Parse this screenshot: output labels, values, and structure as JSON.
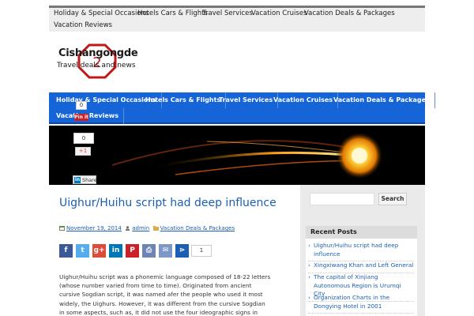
{
  "top_nav": [
    "Holiday & Special Occasions",
    "Hotels Cars & Flights",
    "Travel Services",
    "Vacation Cruises",
    "Vacation Deals & Packages",
    "Vacation Reviews"
  ],
  "logo": {
    "name": "Cishangongde",
    "tagline": "Travel deals and news"
  },
  "main_nav": [
    "Holiday & Special Occasions",
    "Hotels Cars & Flights",
    "Travel Services",
    "Vacation Cruises",
    "Vacation Deals & Packages",
    "Vacation Reviews"
  ],
  "floating_share": {
    "pin_count": "0",
    "pin_label": "Pin it",
    "gplus_count": "0",
    "gplus_label": "+1",
    "linkedin_label": "Share"
  },
  "post": {
    "title": "Uighur/Huihu script had deep influence",
    "date": "November 19, 2014",
    "author": "admin",
    "category": "Vacation Deals & Packages",
    "share_count": "1",
    "body": "Uighur/Huihu script was a phonemic language composed of 18-22 letters (whose number varied from time to time). Originated from ancient cursive Sogdian script, it was named afer the people who used it most widely, the Uighurs. However, it was different from the cursive Sogdian in some aspects, such as, it did not use the four ideographic signs in Sogdian and added"
  },
  "share_icons": [
    {
      "name": "facebook-icon",
      "glyph": "f",
      "color": "#3b5998"
    },
    {
      "name": "twitter-icon",
      "glyph": "t",
      "color": "#55acee"
    },
    {
      "name": "google-plus-icon",
      "glyph": "g+",
      "color": "#dd4b39"
    },
    {
      "name": "linkedin-icon",
      "glyph": "in",
      "color": "#0077b5"
    },
    {
      "name": "pinterest-icon",
      "glyph": "P",
      "color": "#cb2027"
    },
    {
      "name": "print-icon",
      "glyph": "⎙",
      "color": "#6d84b4"
    },
    {
      "name": "email-icon",
      "glyph": "✉",
      "color": "#7d98c8"
    },
    {
      "name": "share-more-icon",
      "glyph": "⋗",
      "color": "#1a5fb4"
    }
  ],
  "sidebar": {
    "search_button": "Search",
    "recent_title": "Recent Posts",
    "recent_posts": [
      "Uighur/Huihu script had deep influence",
      "Xingxiwang Khan and Left General",
      "The capital of Xinjiang Autonomous Region is Urumqi City",
      "Organization Charts in the Dongying Hotel in 2001"
    ]
  },
  "colors": {
    "nav_blue": "#1564d8",
    "link_blue": "#1a5fb4",
    "top_bar": "#eeeeee"
  }
}
